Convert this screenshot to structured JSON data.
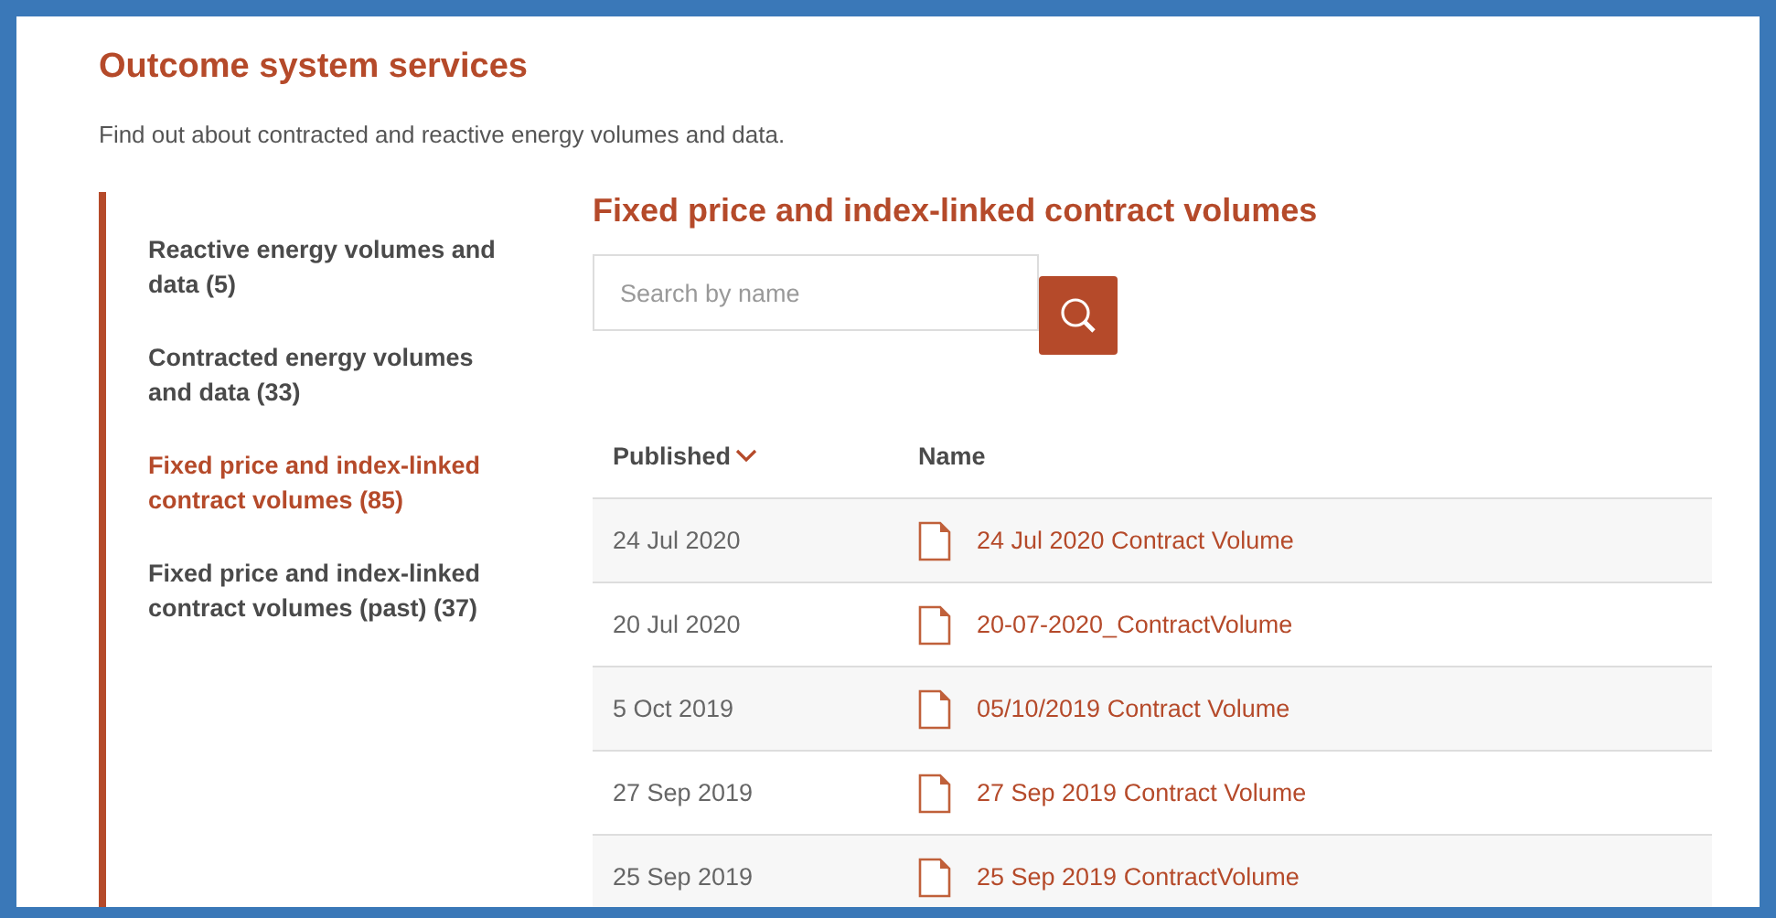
{
  "page": {
    "title": "Outcome system services",
    "description": "Find out about contracted and reactive energy volumes and data."
  },
  "sidebar": {
    "items": [
      {
        "label": "Reactive energy volumes and data (5)",
        "selected": false
      },
      {
        "label": "Contracted energy volumes and data (33)",
        "selected": false
      },
      {
        "label": "Fixed price and index-linked contract volumes (85)",
        "selected": true
      },
      {
        "label": "Fixed price and index-linked contract volumes (past) (37)",
        "selected": false
      }
    ]
  },
  "content": {
    "heading": "Fixed price and index-linked contract volumes",
    "search": {
      "placeholder": "Search by name"
    },
    "table": {
      "columns": [
        {
          "label": "Published",
          "sorted": true
        },
        {
          "label": "Name",
          "sorted": false
        }
      ],
      "rows": [
        {
          "published": "24 Jul 2020",
          "name": "24 Jul 2020 Contract Volume"
        },
        {
          "published": "20 Jul 2020",
          "name": "20-07-2020_ContractVolume"
        },
        {
          "published": "5 Oct 2019",
          "name": "05/10/2019 Contract Volume"
        },
        {
          "published": "27 Sep 2019",
          "name": "27 Sep 2019 Contract Volume"
        },
        {
          "published": "25 Sep 2019",
          "name": "25 Sep 2019 ContractVolume"
        }
      ]
    }
  }
}
